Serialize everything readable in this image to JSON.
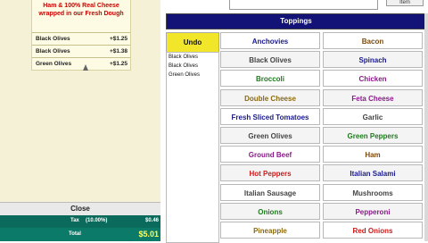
{
  "order": {
    "description": "Ham & 100% Real Cheese wrapped in our Fresh Dough",
    "modifiers": [
      {
        "name": "Black Olives",
        "price": "+$1.25"
      },
      {
        "name": "Black Olives",
        "price": "+$1.38"
      },
      {
        "name": "Green Olives",
        "price": "+$1.25"
      }
    ],
    "close_label": "Close",
    "tax_label": "Tax",
    "tax_pct": "(10.00%)",
    "tax_amount": "$0.46",
    "total_label": "Total",
    "total_amount": "$5.01"
  },
  "top": {
    "edit_label": "Item"
  },
  "toppings": {
    "header": "Toppings",
    "undo_label": "Undo",
    "selected": [
      "Black Olives",
      "Black Olives",
      "Green Olives"
    ],
    "items": [
      {
        "label": "Anchovies",
        "color": "#1a1a8c"
      },
      {
        "label": "Bacon",
        "color": "#7a4a10"
      },
      {
        "label": "Black Olives",
        "color": "#444444"
      },
      {
        "label": "Spinach",
        "color": "#1a1a8c"
      },
      {
        "label": "Broccoli",
        "color": "#1f7a1f"
      },
      {
        "label": "Chicken",
        "color": "#8a1a8a"
      },
      {
        "label": "Double Cheese",
        "color": "#8a6a10"
      },
      {
        "label": "Feta Cheese",
        "color": "#8a1a8a"
      },
      {
        "label": "Fresh Sliced Tomatoes",
        "color": "#1a1a8c"
      },
      {
        "label": "Garlic",
        "color": "#444444"
      },
      {
        "label": "Green Olives",
        "color": "#444444"
      },
      {
        "label": "Green Peppers",
        "color": "#1f7a1f"
      },
      {
        "label": "Ground Beef",
        "color": "#8a1a8a"
      },
      {
        "label": "Ham",
        "color": "#7a4a10"
      },
      {
        "label": "Hot Peppers",
        "color": "#cc1a1a"
      },
      {
        "label": "Italian Salami",
        "color": "#1a1a8c"
      },
      {
        "label": "Italian Sausage",
        "color": "#444444"
      },
      {
        "label": "Mushrooms",
        "color": "#444444"
      },
      {
        "label": "Onions",
        "color": "#1f7a1f"
      },
      {
        "label": "Pepperoni",
        "color": "#8a1a8a"
      },
      {
        "label": "Pineapple",
        "color": "#8a6a10"
      },
      {
        "label": "Red Onions",
        "color": "#cc1a1a"
      }
    ]
  }
}
